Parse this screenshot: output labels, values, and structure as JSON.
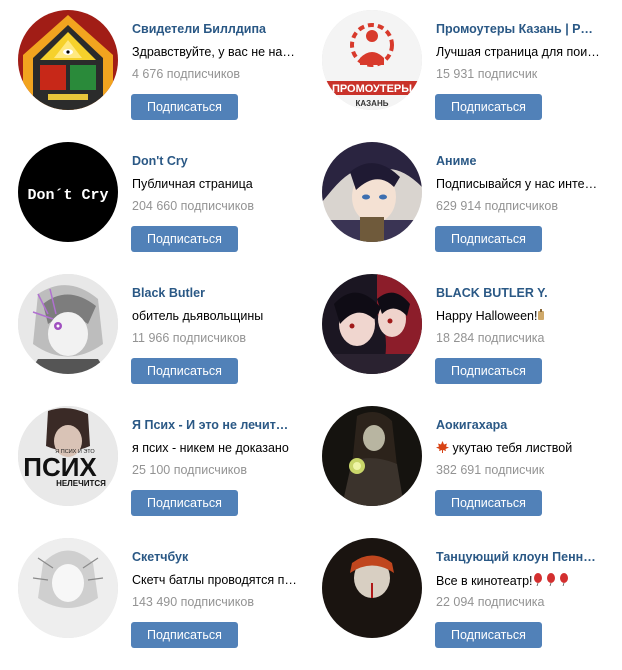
{
  "subscribe_label": "Подписаться",
  "communities": [
    {
      "name": "Свидетели Биллдипа",
      "description": "Здравствуйте, у вас не найдется минутки",
      "subscribers": "4 676 подписчиков"
    },
    {
      "name": "Промоутеры Казань | Работа",
      "description": "Лучшая страница для поиска работы",
      "subscribers": "15 931 подписчик"
    },
    {
      "name": "Don't Cry",
      "description": "Публичная страница",
      "subscribers": "204 660 подписчиков"
    },
    {
      "name": "Аниме",
      "description": "Подписывайся у нас интересно",
      "subscribers": "629 914 подписчиков"
    },
    {
      "name": "Black Butler",
      "description": "обитель дьявольщины",
      "subscribers": "11 966 подписчиков"
    },
    {
      "name": "BLACK BUTLER Y.",
      "description": "Happy Halloween!",
      "subscribers": "18 284 подписчика"
    },
    {
      "name": "Я Псих - И это не лечится|",
      "description": "я псих - никем не доказано",
      "subscribers": "25 100 подписчиков"
    },
    {
      "name": "Аокигахара",
      "description": "укутаю тебя листвой",
      "subscribers": "382 691 подписчик"
    },
    {
      "name": "Скетчбук",
      "description": "Скетч батлы проводятся по выходным",
      "subscribers": "143 490 подписчиков"
    },
    {
      "name": "Танцующий клоун Пеннивайз",
      "description": "Все в кинотеатр!",
      "subscribers": "22 094 подписчика"
    }
  ],
  "avatar_texts": {
    "dont_cry": "Don´t Cry",
    "promo": "ПРОМОУТЕРЫ",
    "promo_city": "КАЗАНЬ",
    "psih_small": "Я ПСИХ И ЭТО",
    "psih": "ПСИХ",
    "psih_bottom": "НЕЛЕЧИТСЯ"
  },
  "colors": {
    "link": "#2a5885",
    "button": "#5181b8",
    "muted": "#939393"
  }
}
